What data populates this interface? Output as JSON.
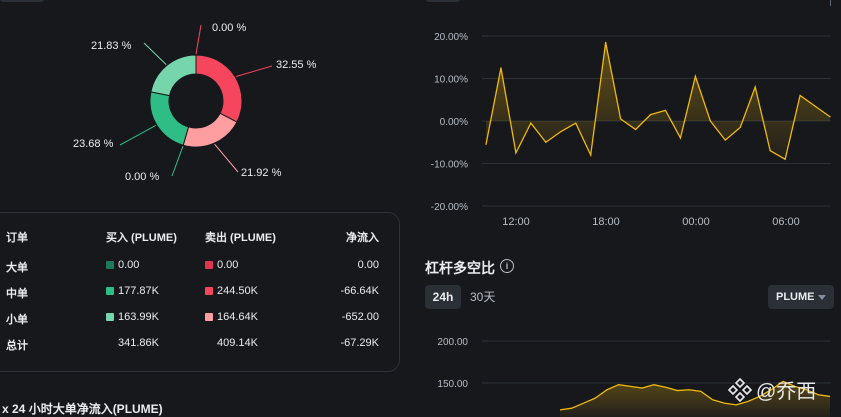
{
  "donut": {
    "segments": [
      {
        "label": "0.00 %",
        "value": 0.0,
        "color": "#f6465d"
      },
      {
        "label": "32.55 %",
        "value": 32.55,
        "color": "#f6465d"
      },
      {
        "label": "21.92 %",
        "value": 21.92,
        "color": "#ff9ea0"
      },
      {
        "label": "0.00 %",
        "value": 0.0,
        "color": "#2ebd85"
      },
      {
        "label": "23.68 %",
        "value": 23.68,
        "color": "#2ebd85"
      },
      {
        "label": "21.83 %",
        "value": 21.83,
        "color": "#76d5ab"
      }
    ]
  },
  "table": {
    "headers": {
      "type": "订单",
      "buy": "买入 (PLUME)",
      "sell": "卖出 (PLUME)",
      "net": "净流入"
    },
    "rows": [
      {
        "type": "大单",
        "buy": "0.00",
        "sell": "0.00",
        "net": "0.00",
        "buy_color": "#1f7a57",
        "sell_color": "#e0354e"
      },
      {
        "type": "中单",
        "buy": "177.87K",
        "sell": "244.50K",
        "net": "-66.64K",
        "buy_color": "#2ebd85",
        "sell_color": "#f6465d"
      },
      {
        "type": "小单",
        "buy": "163.99K",
        "sell": "164.64K",
        "net": "-652.00",
        "buy_color": "#76d5ab",
        "sell_color": "#ff9ea0"
      }
    ],
    "total": {
      "type": "总计",
      "buy": "341.86K",
      "sell": "409.14K",
      "net": "-67.29K"
    }
  },
  "bottom_title": "x 24 小时大单净流入(PLUME)",
  "chart_data": [
    {
      "type": "area",
      "y_ticks": [
        "20.00%",
        "10.00%",
        "0.00%",
        "-10.00%",
        "-20.00%"
      ],
      "x_ticks": [
        "12:00",
        "18:00",
        "00:00",
        "06:00"
      ],
      "ylim": [
        -20,
        20
      ],
      "values": [
        -5.5,
        12.5,
        -7.5,
        -0.5,
        -5,
        -2.5,
        -0.5,
        -8,
        18.5,
        0.5,
        -2,
        1.5,
        2.5,
        -4,
        10.5,
        0,
        -4.5,
        -1.5,
        8,
        -7,
        -9,
        6,
        3.5,
        1
      ],
      "color": "#f0b90b"
    },
    {
      "type": "area",
      "y_ticks": [
        "200.00",
        "150.00"
      ],
      "values": [
        88,
        90,
        96,
        102,
        112,
        118,
        116,
        114,
        118,
        115,
        111,
        112,
        110,
        100,
        96,
        94,
        98,
        104,
        112,
        122,
        116,
        112,
        106,
        104
      ],
      "color": "#f0b90b"
    }
  ],
  "section2": {
    "title": "杠杆多空比",
    "info": "i",
    "tab_24h": "24h",
    "tab_30d": "30天",
    "select_value": "PLUME"
  },
  "watermark": "@乔西"
}
